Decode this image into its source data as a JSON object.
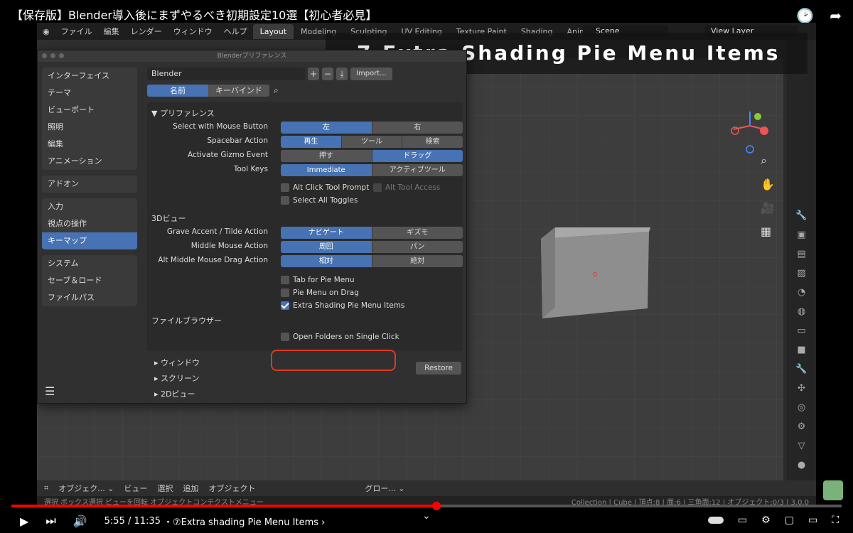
{
  "video": {
    "title": "【保存版】Blender導入後にまずやるべき初期設定10選【初心者必見】",
    "time": "5:55 / 11:35",
    "chapter": "・⑦Extra shading Pie Menu Items ›",
    "progress_fraction": 0.512
  },
  "topbar": {
    "menus": [
      "ファイル",
      "編集",
      "レンダー",
      "ウィンドウ",
      "ヘルプ"
    ],
    "workspaces": [
      "Layout",
      "Modeling",
      "Sculpting",
      "UV Editing",
      "Texture Paint",
      "Shading",
      "Animati"
    ],
    "active_workspace": "Layout",
    "scene": "Scene",
    "view_layer": "View Layer"
  },
  "overlay": {
    "title": "7.Extra Shading Pie Menu Items"
  },
  "viewport": {
    "options_label": "オプション ⌄"
  },
  "prefs": {
    "window_title": "Blenderプリファレンス",
    "sidebar_groups": [
      [
        "インターフェイス",
        "テーマ",
        "ビューポート",
        "照明",
        "編集",
        "アニメーション"
      ],
      [
        "アドオン"
      ],
      [
        "入力",
        "視点の操作",
        "キーマップ"
      ],
      [
        "システム",
        "セーブ＆ロード",
        "ファイルパス"
      ]
    ],
    "active_item": "キーマップ",
    "preset": "Blender",
    "import_label": "Import...",
    "tabs": [
      "名前",
      "キーバインド"
    ],
    "panel_title": "▼ プリファレンス",
    "rows_top": [
      {
        "label": "Select with Mouse Button",
        "options": [
          "左",
          "右"
        ],
        "on": 0
      },
      {
        "label": "Spacebar Action",
        "options": [
          "再生",
          "ツール",
          "検索"
        ],
        "on": 0
      },
      {
        "label": "Activate Gizmo Event",
        "options": [
          "押す",
          "ドラッグ"
        ],
        "on": 1
      },
      {
        "label": "Tool Keys",
        "options": [
          "Immediate",
          "アクティブツール"
        ],
        "on": 0
      }
    ],
    "alt_click": "Alt Click Tool Prompt",
    "alt_tool_access": "Alt Tool Access",
    "select_all": "Select All Toggles",
    "section_3d": "3Dビュー",
    "rows_3d": [
      {
        "label": "Grave Accent / Tilde Action",
        "options": [
          "ナビゲート",
          "ギズモ"
        ],
        "on": 0
      },
      {
        "label": "Middle Mouse Action",
        "options": [
          "周回",
          "パン"
        ],
        "on": 0
      },
      {
        "label": "Alt Middle Mouse Drag Action",
        "options": [
          "相対",
          "絶対"
        ],
        "on": 0
      }
    ],
    "tab_pie": "Tab for Pie Menu",
    "pie_drag": "Pie Menu on Drag",
    "extra_shading": "Extra Shading Pie Menu Items",
    "section_file": "ファイルブラウザー",
    "open_folders": "Open Folders on Single Click",
    "collapsed": [
      "▸ ウィンドウ",
      "▸ スクリーン",
      "▸ 2Dビュー"
    ],
    "restore": "Restore"
  },
  "bottom_header": {
    "items": [
      "オブジェク... ⌄",
      "ビュー",
      "選択",
      "追加",
      "オブジェクト",
      "グロー... ⌄"
    ]
  },
  "statusbar": {
    "left": "選択    ボックス選択    ビューを回転    オブジェクトコンテクストメニュー",
    "stats": "Collection | Cube | 頂点:8 | 面:6 | 三角面:12 | オブジェクト:0/3 | 3.0.0"
  }
}
